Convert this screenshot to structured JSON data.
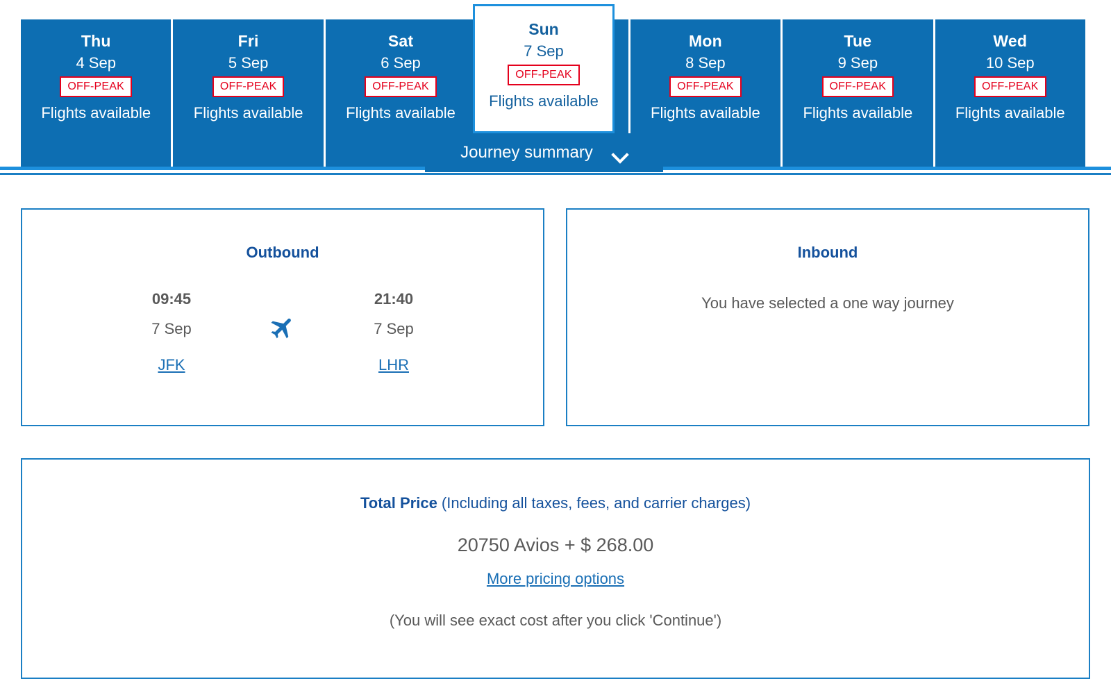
{
  "date_strip": {
    "days": [
      {
        "dow": "Thu",
        "date": "4 Sep",
        "badge": "OFF-PEAK",
        "availability": "Flights available",
        "selected": false
      },
      {
        "dow": "Fri",
        "date": "5 Sep",
        "badge": "OFF-PEAK",
        "availability": "Flights available",
        "selected": false
      },
      {
        "dow": "Sat",
        "date": "6 Sep",
        "badge": "OFF-PEAK",
        "availability": "Flights available",
        "selected": false
      },
      {
        "dow": "Sun",
        "date": "7 Sep",
        "badge": "OFF-PEAK",
        "availability": "Flights available",
        "selected": true
      },
      {
        "dow": "Mon",
        "date": "8 Sep",
        "badge": "OFF-PEAK",
        "availability": "Flights available",
        "selected": false
      },
      {
        "dow": "Tue",
        "date": "9 Sep",
        "badge": "OFF-PEAK",
        "availability": "Flights available",
        "selected": false
      },
      {
        "dow": "Wed",
        "date": "10 Sep",
        "badge": "OFF-PEAK",
        "availability": "Flights available",
        "selected": false
      }
    ],
    "selected_day": {
      "dow": "Sun",
      "date": "7 Sep",
      "badge": "OFF-PEAK",
      "availability": "Flights available"
    },
    "journey_summary": {
      "label": "Journey summary",
      "icon": "chevron-down-icon",
      "expanded": false
    }
  },
  "outbound": {
    "title": "Outbound",
    "depart_time": "09:45",
    "depart_date": "7 Sep",
    "depart_airport": "JFK",
    "arrive_time": "21:40",
    "arrive_date": "7 Sep",
    "arrive_airport": "LHR",
    "icon": "airplane-icon"
  },
  "inbound": {
    "title": "Inbound",
    "message": "You have selected a one way journey"
  },
  "price": {
    "title": "Total Price",
    "title_suffix": " (Including all taxes, fees, and carrier charges)",
    "amount": "20750 Avios + $ 268.00",
    "more_options_link": "More pricing options",
    "note": "(You will see exact cost after you click 'Continue')"
  },
  "colors": {
    "brand_blue": "#0d6eb2",
    "accent_blue": "#1d90dd",
    "border_blue": "#1b7fc4",
    "heading_blue": "#14519c",
    "link_blue": "#1a6fb5",
    "badge_red": "#e4001c",
    "body_grey": "#595959"
  }
}
